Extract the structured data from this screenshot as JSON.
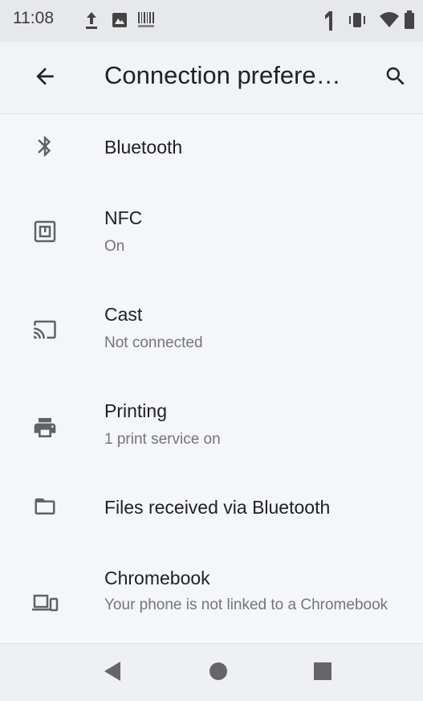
{
  "status_bar": {
    "time": "11:08",
    "icons": [
      "upload-icon",
      "photo-icon",
      "barcode-icon",
      "signal-icon",
      "vibrate-icon",
      "wifi-icon",
      "battery-icon"
    ]
  },
  "app_bar": {
    "title": "Connection prefere…",
    "back_icon": "arrow-back-icon",
    "search_icon": "search-icon"
  },
  "items": [
    {
      "icon": "bluetooth-icon",
      "title": "Bluetooth",
      "subtitle": ""
    },
    {
      "icon": "nfc-icon",
      "title": "NFC",
      "subtitle": "On"
    },
    {
      "icon": "cast-icon",
      "title": "Cast",
      "subtitle": "Not connected"
    },
    {
      "icon": "printer-icon",
      "title": "Printing",
      "subtitle": "1 print service on"
    },
    {
      "icon": "folder-icon",
      "title": "Files received via Bluetooth",
      "subtitle": ""
    },
    {
      "icon": "devices-icon",
      "title": "Chromebook",
      "subtitle": "Your phone is not linked to a Chromebook"
    }
  ],
  "nav_bar": {
    "icons": [
      "back-triangle-icon",
      "home-circle-icon",
      "overview-square-icon"
    ]
  },
  "colors": {
    "background": "#f4f6f9",
    "status_bar": "#e6e8eb",
    "primary_text": "#202124",
    "secondary_text": "#757575",
    "icon": "#5f6368"
  }
}
